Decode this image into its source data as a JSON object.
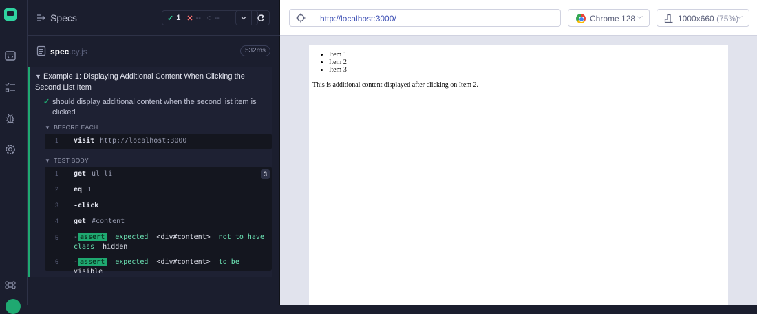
{
  "header": {
    "specs_label": "Specs",
    "passed": "1",
    "failed": "--",
    "pending": "--"
  },
  "spec_file": {
    "name": "spec",
    "ext": ".cy.js",
    "duration": "532ms"
  },
  "suite": {
    "title": "Example 1: Displaying Additional Content When Clicking the Second List Item",
    "test_title": "should display additional content when the second list item is clicked",
    "before_each_label": "BEFORE EACH",
    "test_body_label": "TEST BODY",
    "before_each": [
      {
        "num": "1",
        "name": "visit",
        "msg": "http://localhost:3000"
      }
    ],
    "test_body": [
      {
        "num": "1",
        "name": "get",
        "msg": "ul li",
        "badge": "3"
      },
      {
        "num": "2",
        "name": "eq",
        "msg": "1"
      },
      {
        "num": "3",
        "name": "-click",
        "msg": ""
      },
      {
        "num": "4",
        "name": "get",
        "msg": "#content"
      },
      {
        "num": "5",
        "assert_tag": "assert",
        "assert_text_1": "expected",
        "assert_subject": "<div#content>",
        "assert_text_2": "not to have",
        "assert_text_3": "class",
        "assert_value": "hidden"
      },
      {
        "num": "6",
        "assert_tag": "assert",
        "assert_text_1": "expected",
        "assert_subject": "<div#content>",
        "assert_text_2": "to be",
        "assert_value": "visible"
      }
    ]
  },
  "browser_bar": {
    "url": "http://localhost:3000/",
    "browser": "Chrome 128",
    "viewport": "1000x660",
    "viewport_pct": "(75%)"
  },
  "aut": {
    "items": [
      "Item 1",
      "Item 2",
      "Item 3"
    ],
    "content": "This is additional content displayed after clicking on Item 2."
  },
  "colors": {
    "accent_green": "#1fa971",
    "panel_bg": "#1b1e2e",
    "url_blue": "#3f51b5"
  },
  "icons": [
    "cypress-logo-icon",
    "runs-icon",
    "specs-list-icon",
    "debug-bug-icon",
    "settings-gear-icon",
    "keyboard-shortcuts-icon",
    "specs-nav-icon",
    "document-icon",
    "chevron-down-icon",
    "reload-icon",
    "crosshair-target-icon",
    "chrome-icon",
    "viewport-icon"
  ]
}
